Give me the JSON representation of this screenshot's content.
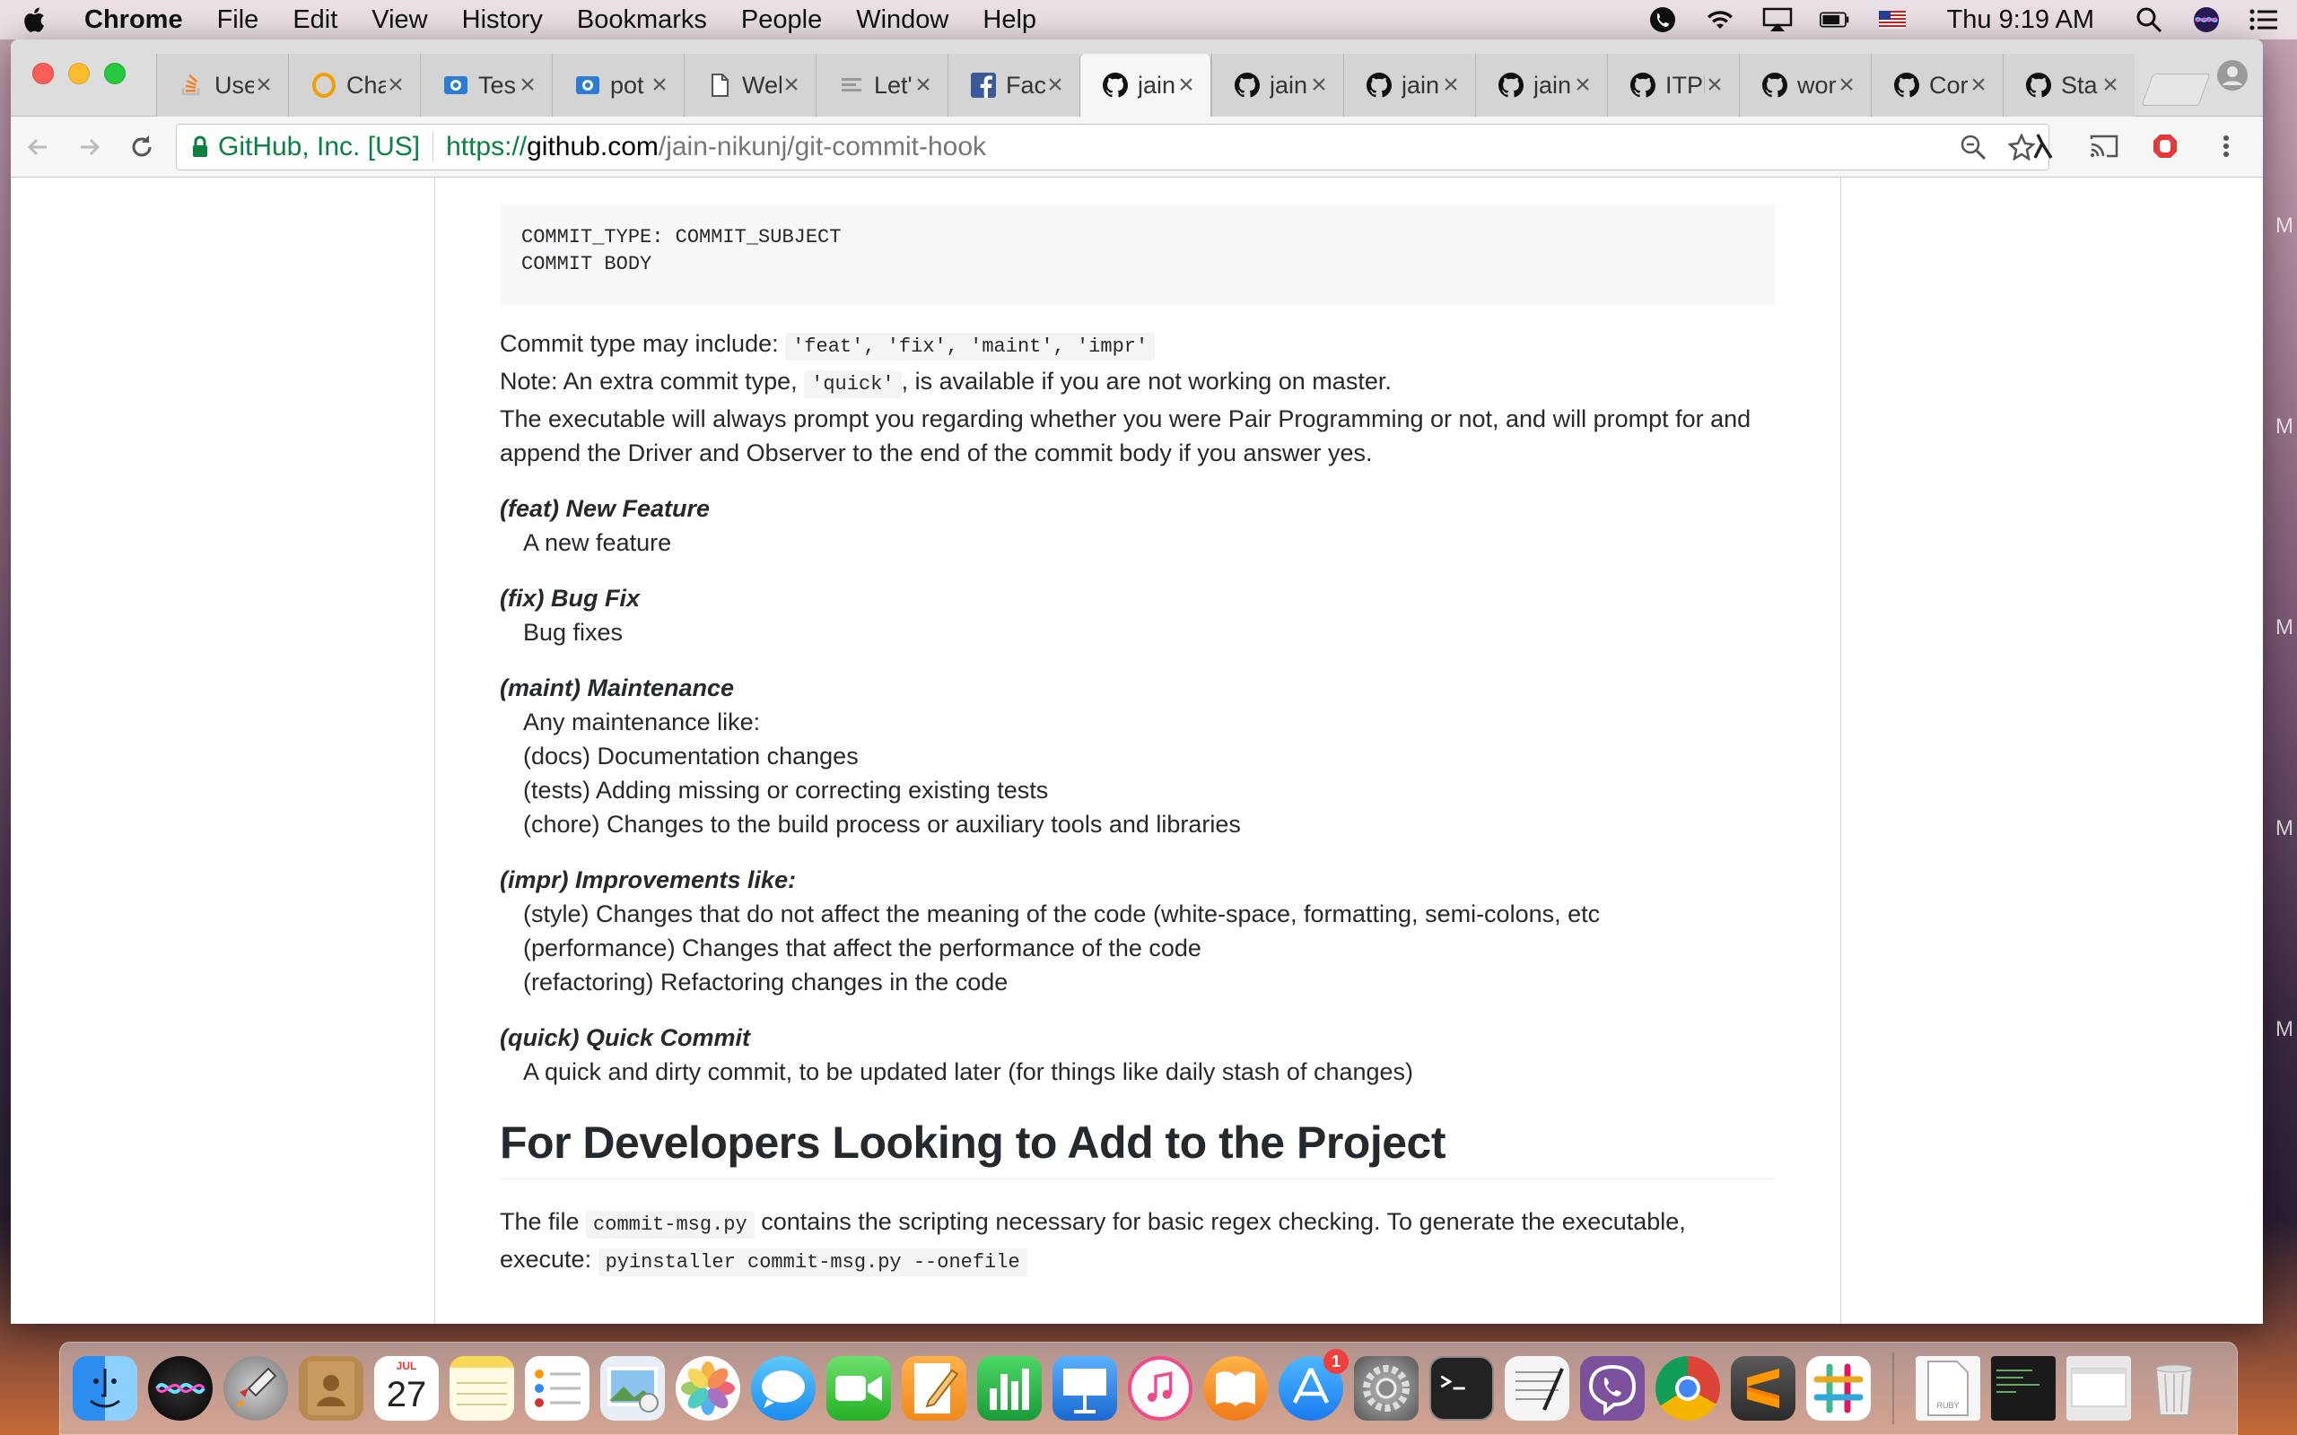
{
  "menubar": {
    "app_name": "Chrome",
    "items": [
      "File",
      "Edit",
      "View",
      "History",
      "Bookmarks",
      "People",
      "Window",
      "Help"
    ],
    "clock": "Thu 9:19 AM"
  },
  "tabs": [
    {
      "title": "Use",
      "icon": "stackoverflow-icon"
    },
    {
      "title": "Cha",
      "icon": "opera-icon"
    },
    {
      "title": "Tes",
      "icon": "screenshot-icon"
    },
    {
      "title": "pot",
      "icon": "screenshot-icon"
    },
    {
      "title": "Wel",
      "icon": "document-icon"
    },
    {
      "title": "Let'",
      "icon": "list-icon"
    },
    {
      "title": "Fac",
      "icon": "facebook-icon"
    },
    {
      "title": "jain",
      "icon": "github-icon",
      "active": true
    },
    {
      "title": "jain",
      "icon": "github-icon"
    },
    {
      "title": "jain",
      "icon": "github-icon"
    },
    {
      "title": "jain",
      "icon": "github-icon"
    },
    {
      "title": "ITPl",
      "icon": "github-icon"
    },
    {
      "title": "wor",
      "icon": "github-icon"
    },
    {
      "title": "Cor",
      "icon": "github-icon"
    },
    {
      "title": "Sta",
      "icon": "github-icon"
    }
  ],
  "omnibox": {
    "cert_owner": "GitHub, Inc. [US]",
    "scheme": "https://",
    "host": "github.com",
    "path": "/jain-nikunj/git-commit-hook"
  },
  "readme": {
    "code_lines": [
      "COMMIT_TYPE: COMMIT_SUBJECT",
      "COMMIT BODY"
    ],
    "types_prefix": "Commit type may include: ",
    "types_code": "'feat', 'fix', 'maint', 'impr'",
    "note_prefix": "Note: An extra commit type, ",
    "note_code": "'quick'",
    "note_suffix": ", is available if you are not working on master.",
    "pair_line_1": "The executable will always prompt you regarding whether you were Pair Programming or not, and will prompt for and",
    "pair_line_2": "append the Driver and Observer to the end of the commit body if you answer yes.",
    "definitions": [
      {
        "term": "(feat) New Feature",
        "lines": [
          "A new feature"
        ]
      },
      {
        "term": "(fix) Bug Fix",
        "lines": [
          "Bug fixes"
        ]
      },
      {
        "term": "(maint) Maintenance",
        "lines": [
          "Any maintenance like:",
          "(docs) Documentation changes",
          "(tests) Adding missing or correcting existing tests",
          "(chore) Changes to the build process or auxiliary tools and libraries"
        ]
      },
      {
        "term": "(impr) Improvements like:",
        "lines": [
          "(style) Changes that do not affect the meaning of the code (white-space, formatting, semi-colons, etc",
          "(performance) Changes that affect the performance of the code",
          "(refactoring) Refactoring changes in the code"
        ]
      },
      {
        "term": "(quick) Quick Commit",
        "lines": [
          "A quick and dirty commit, to be updated later (for things like daily stash of changes)"
        ]
      }
    ],
    "dev_heading": "For Developers Looking to Add to the Project",
    "dev_p_prefix": "The file ",
    "dev_p_file": "commit-msg.py",
    "dev_p_middle": " contains the scripting necessary for basic regex checking. To generate the executable,",
    "dev_p_execute": "execute: ",
    "dev_p_cmd": "pyinstaller commit-msg.py --onefile"
  },
  "right_peek": [
    "M",
    "M",
    "M",
    "M",
    "M"
  ],
  "dock": {
    "calendar_month": "JUL",
    "calendar_day": "27",
    "appstore_badge": "1",
    "apps": [
      "finder-icon",
      "siri-icon",
      "launchpad-icon",
      "contacts-icon",
      "calendar-icon",
      "notes-icon",
      "reminders-icon",
      "preview-icon",
      "photos-icon",
      "messages-icon",
      "facetime-icon",
      "pages-icon",
      "numbers-icon",
      "keynote-icon",
      "itunes-icon",
      "ibooks-icon",
      "appstore-icon",
      "system-preferences-icon",
      "terminal-icon",
      "textedit-icon",
      "viber-icon",
      "chrome-icon",
      "sublime-icon",
      "slack-icon"
    ]
  }
}
